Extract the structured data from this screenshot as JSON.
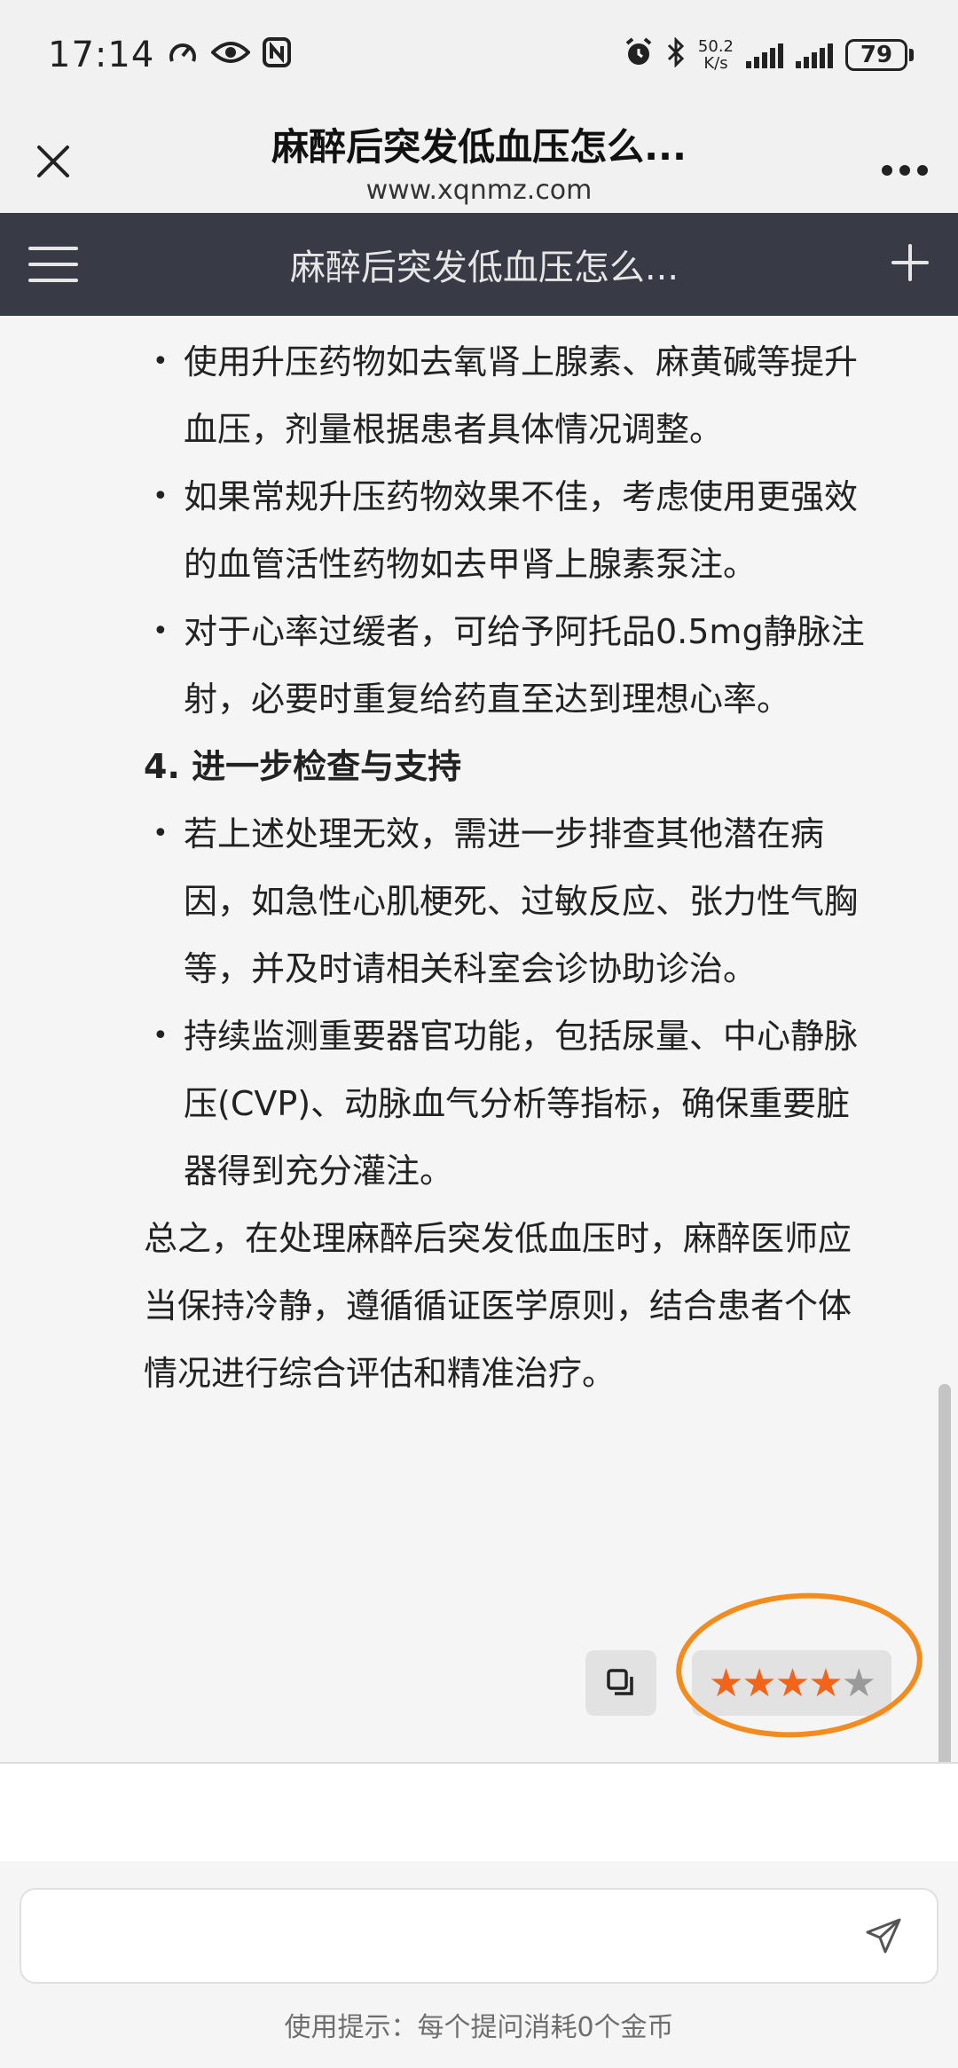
{
  "status_bar": {
    "time": "17:14",
    "net_speed_value": "50.2",
    "net_speed_unit": "K/s",
    "battery": "79"
  },
  "browser": {
    "title": "麻醉后突发低血压怎么...",
    "url": "www.xqnmz.com"
  },
  "site_nav": {
    "title": "麻醉后突发低血压怎么..."
  },
  "content": {
    "bullets_a": [
      "使用升压药物如去氧肾上腺素、麻黄碱等提升血压，剂量根据患者具体情况调整。",
      "如果常规升压药物效果不佳，考虑使用更强效的血管活性药物如去甲肾上腺素泵注。",
      "对于心率过缓者，可给予阿托品0.5mg静脉注射，必要时重复给药直至达到理想心率。"
    ],
    "section_heading": "4. 进一步检查与支持",
    "bullets_b": [
      "若上述处理无效，需进一步排查其他潜在病因，如急性心肌梗死、过敏反应、张力性气胸等，并及时请相关科室会诊协助诊治。",
      "持续监测重要器官功能，包括尿量、中心静脉压(CVP)、动脉血气分析等指标，确保重要脏器得到充分灌注。"
    ],
    "summary": "总之，在处理麻醉后突发低血压时，麻醉医师应当保持冷静，遵循循证医学原则，结合患者个体情况进行综合评估和精准治疗。"
  },
  "rating": {
    "value": 4,
    "max": 5,
    "filled_color": "#f26419",
    "empty_color": "#9a9a9a"
  },
  "input": {
    "placeholder": "",
    "value": ""
  },
  "hint": "使用提示：每个提问消耗0个金币",
  "colors": {
    "nav_bg": "#383b45",
    "highlight": "#f28c1f"
  }
}
